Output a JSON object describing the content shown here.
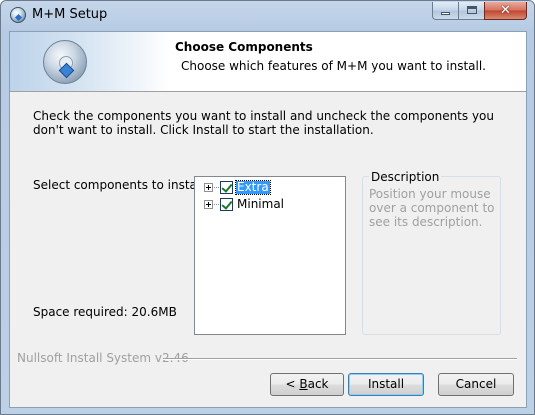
{
  "window": {
    "title": "M+M Setup"
  },
  "caption": {
    "minimize": "",
    "maximize": "",
    "close": "✕"
  },
  "header": {
    "title": "Choose Components",
    "subtitle": "Choose which features of M+M you want to install."
  },
  "intro": "Check the components you want to install and uncheck the components you don't want to install. Click Install to start the installation.",
  "components": {
    "label": "Select components to install:",
    "items": [
      {
        "label": "Extra",
        "checked": true,
        "selected": true
      },
      {
        "label": "Minimal",
        "checked": true,
        "selected": false
      }
    ]
  },
  "space_required": "Space required: 20.6MB",
  "description": {
    "title": "Description",
    "text": "Position your mouse over a component to see its description."
  },
  "branding": "Nullsoft Install System v2.46",
  "buttons": {
    "back_prefix": "< ",
    "back_underlined": "B",
    "back_rest": "ack",
    "install": "Install",
    "cancel": "Cancel"
  }
}
